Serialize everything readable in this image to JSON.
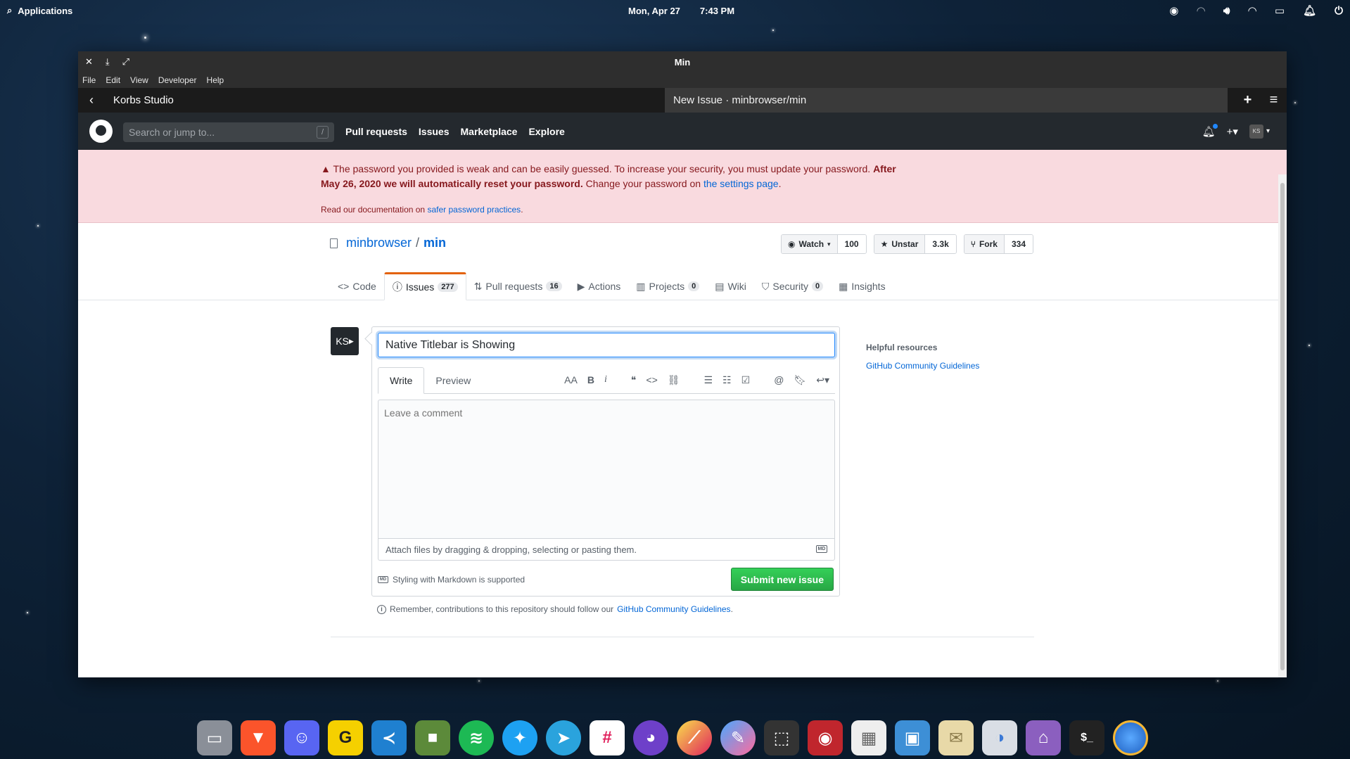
{
  "top_panel": {
    "applications_label": "Applications",
    "date": "Mon, Apr 27",
    "time": "7:43 PM"
  },
  "window": {
    "title": "Min",
    "controls": [
      "✕",
      "⤓",
      "⤢"
    ],
    "menu": [
      "File",
      "Edit",
      "View",
      "Developer",
      "Help"
    ]
  },
  "browser": {
    "tab1_title": "Korbs Studio",
    "tab2_title": "New Issue · minbrowser/min"
  },
  "github": {
    "search_placeholder": "Search or jump to...",
    "search_key": "/",
    "nav_links": [
      "Pull requests",
      "Issues",
      "Marketplace",
      "Explore"
    ],
    "avatar_initials": "KS"
  },
  "flash": {
    "text_part1": "The password you provided is weak and can be easily guessed. To increase your security, you must update your password.",
    "text_bold": "After May 26, 2020 we will automatically reset your password.",
    "text_part2": "Change your password on",
    "settings_link": "the settings page",
    "period": ".",
    "doc_text": "Read our documentation on",
    "doc_link": "safer password practices",
    "doc_period": "."
  },
  "repo": {
    "owner": "minbrowser",
    "separator": "/",
    "name": "min",
    "watch_label": "Watch",
    "watch_count": "100",
    "star_label": "Unstar",
    "star_count": "3.3k",
    "fork_label": "Fork",
    "fork_count": "334",
    "tabs": [
      {
        "label": "Code",
        "count": ""
      },
      {
        "label": "Issues",
        "count": "277"
      },
      {
        "label": "Pull requests",
        "count": "16"
      },
      {
        "label": "Actions",
        "count": ""
      },
      {
        "label": "Projects",
        "count": "0"
      },
      {
        "label": "Wiki",
        "count": ""
      },
      {
        "label": "Security",
        "count": "0"
      },
      {
        "label": "Insights",
        "count": ""
      }
    ]
  },
  "issue_form": {
    "avatar_initials": "KS",
    "title_value": "Native Titlebar is Showing",
    "tab_write": "Write",
    "tab_preview": "Preview",
    "comment_placeholder": "Leave a comment",
    "attach_text": "Attach files by dragging & dropping, selecting or pasting them.",
    "md_badge": "MD",
    "styling_text": "Styling with Markdown is supported",
    "submit_label": "Submit new issue",
    "remember_text": "Remember, contributions to this repository should follow our",
    "remember_link": "GitHub Community Guidelines",
    "remember_period": "."
  },
  "sidebar": {
    "heading": "Helpful resources",
    "link": "GitHub Community Guidelines"
  },
  "dock_apps": [
    "Files",
    "Brave",
    "Discord",
    "Gnome Guides",
    "VS Code",
    "Minecraft",
    "Spotify",
    "Twitter",
    "Telegram",
    "Slack",
    "GitHub Desktop",
    "Lollypop",
    "Color Picker",
    "Screenshot",
    "Screen Recorder",
    "Calendar",
    "Photos",
    "Mail",
    "Settings",
    "Store",
    "Terminal",
    "Min"
  ]
}
